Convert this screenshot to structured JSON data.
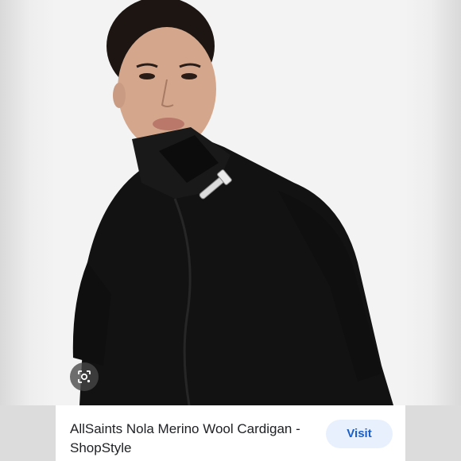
{
  "result": {
    "title": "AllSaints Nola Merino Wool Cardigan - ShopStyle",
    "visit_label": "Visit"
  },
  "icons": {
    "lens": "lens-icon"
  }
}
